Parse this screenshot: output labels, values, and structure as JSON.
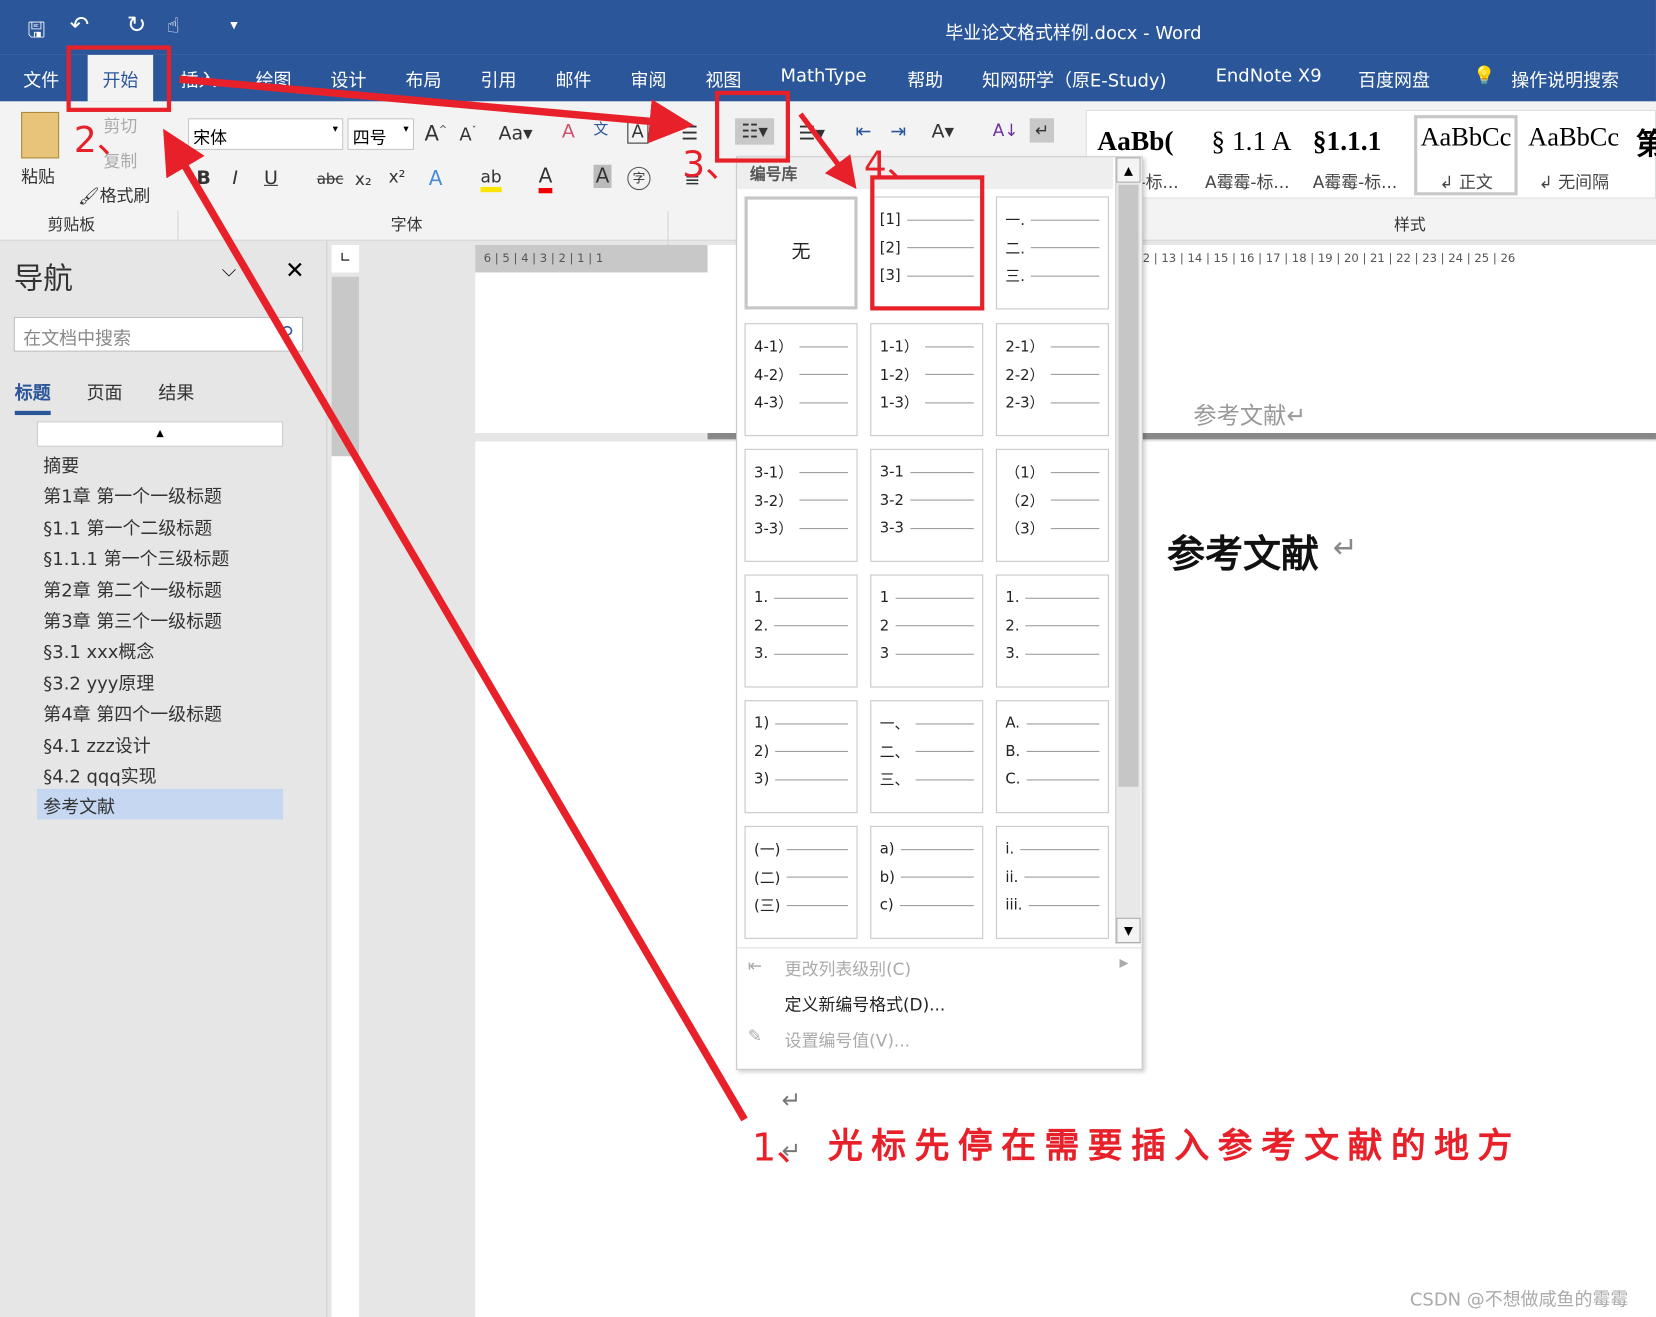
{
  "window": {
    "title": "毕业论文格式样例.docx  -  Word"
  },
  "tabs": [
    "文件",
    "开始",
    "插入",
    "绘图",
    "设计",
    "布局",
    "引用",
    "邮件",
    "审阅",
    "视图",
    "MathType",
    "帮助",
    "知网研学（原E-Study)",
    "EndNote X9",
    "百度网盘",
    "操作说明搜索"
  ],
  "ribbon": {
    "clipboard": {
      "paste": "粘贴",
      "cut": "剪切",
      "copy": "复制",
      "format_painter": "格式刷",
      "group": "剪贴板"
    },
    "font": {
      "name": "宋体",
      "size": "四号",
      "group": "字体"
    },
    "numbering_gallery_label": "编号库",
    "styles": {
      "group": "样式",
      "items": [
        {
          "preview": "AaBb(",
          "name": "-标..."
        },
        {
          "preview": "§ 1.1  A",
          "name": "A霉霉-标..."
        },
        {
          "preview": "§1.1.1",
          "name": "A霉霉-标..."
        },
        {
          "preview": "AaBbCc",
          "name": "↲ 正文"
        },
        {
          "preview": "AaBbCc",
          "name": "↲ 无间隔"
        },
        {
          "preview": "第",
          "name": ""
        }
      ]
    }
  },
  "nav": {
    "title": "导航",
    "search_placeholder": "在文档中搜索",
    "tabs": [
      "标题",
      "页面",
      "结果"
    ],
    "items": [
      "摘要",
      "第1章 第一个一级标题",
      "§1.1 第一个二级标题",
      "§1.1.1 第一个三级标题",
      "第2章 第二个一级标题",
      "第3章 第三个一级标题",
      "§3.1 xxx概念",
      "§3.2 yyy原理",
      "第4章 第四个一级标题",
      "§4.1 zzz设计",
      "§4.2 qqq实现",
      "参考文献"
    ],
    "selected": "参考文献"
  },
  "ruler": {
    "h_left": "6 | 5 | 4 | 3 | 2 | 1 | 1",
    "h_right": "2 | 13 | 14 | 15 | 16 | 17 | 18 | 19 | 20 | 21 | 22 | 23 | 24 | 25 | 26"
  },
  "numbering": {
    "cells": [
      [
        "无"
      ],
      [
        "[1]",
        "[2]",
        "[3]"
      ],
      [
        "一.",
        "二.",
        "三."
      ],
      [
        "4-1）",
        "4-2）",
        "4-3）"
      ],
      [
        "1-1）",
        "1-2）",
        "1-3）"
      ],
      [
        "2-1）",
        "2-2）",
        "2-3）"
      ],
      [
        "3-1）",
        "3-2）",
        "3-3）"
      ],
      [
        "3-1",
        "3-2",
        "3-3"
      ],
      [
        "（1）",
        "（2）",
        "（3）"
      ],
      [
        "1.",
        "2.",
        "3."
      ],
      [
        "1",
        "2",
        "3"
      ],
      [
        "1.",
        "2.",
        "3."
      ],
      [
        "1)",
        "2)",
        "3)"
      ],
      [
        "一、",
        "二、",
        "三、"
      ],
      [
        "A.",
        "B.",
        "C."
      ],
      [
        "(一)",
        "(二)",
        "(三)"
      ],
      [
        "a)",
        "b)",
        "c)"
      ],
      [
        "i.",
        "ii.",
        "iii."
      ]
    ],
    "menu": [
      "更改列表级别(C)",
      "定义新编号格式(D)...",
      "设置编号值(V)..."
    ]
  },
  "document": {
    "header_text": "参考文献↵",
    "heading": "参考文献",
    "return_mark": "↵"
  },
  "annotations": {
    "step1": "1、",
    "step2": "2、",
    "step3": "3、",
    "step4": "4、",
    "note": "光标先停在需要插入参考文献的地方",
    "color": "#e8202a"
  },
  "watermark": "CSDN @不想做咸鱼的霉霉"
}
